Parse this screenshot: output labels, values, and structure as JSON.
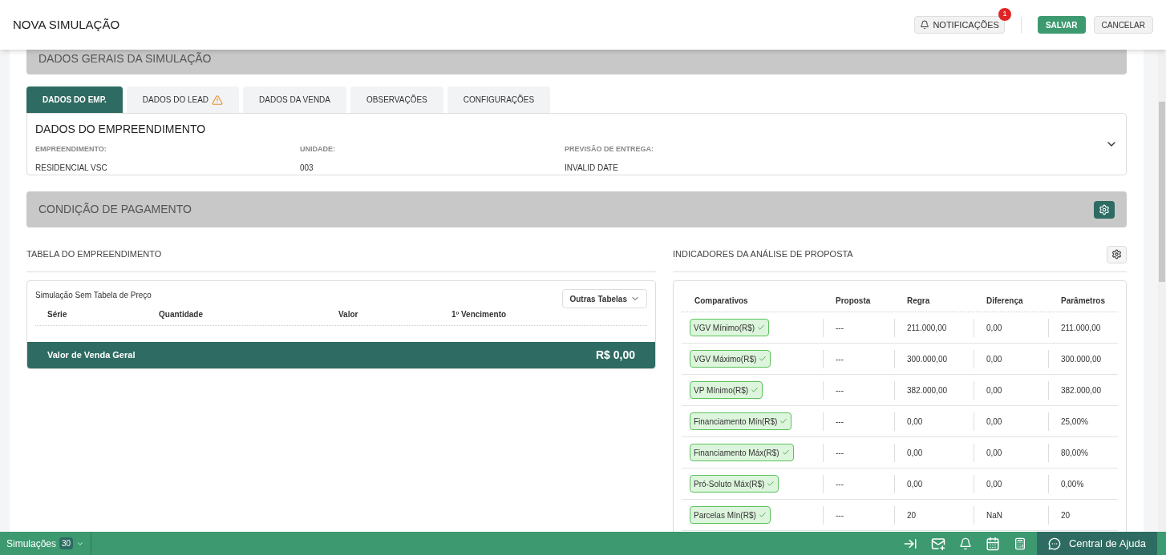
{
  "header": {
    "title": "NOVA SIMULAÇÃO",
    "notifications": {
      "label": "NOTIFICAÇÕES",
      "count": "1"
    },
    "buttons": [
      "SALVAR",
      "CANCELAR"
    ]
  },
  "general_section": {
    "title": "DADOS GERAIS DA SIMULAÇÃO"
  },
  "tabs": [
    {
      "label": "DADOS DO EMP.",
      "selected": true,
      "warning": false
    },
    {
      "label": "DADOS DO LEAD",
      "selected": false,
      "warning": true
    },
    {
      "label": "DADOS DA VENDA",
      "selected": false,
      "warning": false
    },
    {
      "label": "OBSERVAÇÕES",
      "selected": false,
      "warning": false
    },
    {
      "label": "CONFIGURAÇÕES",
      "selected": false,
      "warning": false
    }
  ],
  "empreendimento": {
    "title": "DADOS DO EMPREENDIMENTO",
    "expanded": false,
    "fields": [
      {
        "label": "EMPREENDIMENTO:",
        "value": "RESIDENCIAL VSC"
      },
      {
        "label": "UNIDADE:",
        "value": "003"
      },
      {
        "label": "PREVISÃO DE ENTREGA:",
        "value": "INVALID DATE"
      }
    ]
  },
  "payment_section": {
    "title": "CONDIÇÃO DE PAGAMENTO"
  },
  "price_table": {
    "title": "TABELA DO EMPREENDIMENTO",
    "subtitle": "Simulação Sem Tabela de Preço",
    "dropdown": "Outras Tabelas",
    "columns": [
      "Série",
      "Quantidade",
      "Valor",
      "1º Vencimento"
    ],
    "total_label": "Valor de Venda Geral",
    "total_value": "R$ 0,00"
  },
  "indicators": {
    "title": "INDICADORES DA ANÁLISE DE PROPOSTA",
    "columns": [
      "Comparativos",
      "Proposta",
      "Regra",
      "Diferença",
      "Parâmetros"
    ],
    "rows": [
      {
        "name": "VGV Mínimo(R$)",
        "passed": true,
        "proposta": "---",
        "regra": "211.000,00",
        "diferenca": "0,00",
        "parametros": "211.000,00"
      },
      {
        "name": "VGV Máximo(R$)",
        "passed": true,
        "proposta": "---",
        "regra": "300.000,00",
        "diferenca": "0,00",
        "parametros": "300.000,00"
      },
      {
        "name": "VP Mínimo(R$)",
        "passed": true,
        "proposta": "---",
        "regra": "382.000,00",
        "diferenca": "0,00",
        "parametros": "382.000,00"
      },
      {
        "name": "Financiamento Mín(R$)",
        "passed": true,
        "proposta": "---",
        "regra": "0,00",
        "diferenca": "0,00",
        "parametros": "25,00%"
      },
      {
        "name": "Financiamento Máx(R$)",
        "passed": true,
        "proposta": "---",
        "regra": "0,00",
        "diferenca": "0,00",
        "parametros": "80,00%"
      },
      {
        "name": "Pró-Soluto Máx(R$)",
        "passed": true,
        "proposta": "---",
        "regra": "0,00",
        "diferenca": "0,00",
        "parametros": "0,00%"
      },
      {
        "name": "Parcelas Mín(R$)",
        "passed": true,
        "proposta": "---",
        "regra": "20",
        "diferenca": "NaN",
        "parametros": "20"
      }
    ]
  },
  "bottom_bar": {
    "simulations_label": "Simulações",
    "simulations_count": "30",
    "help_label": "Central de Ajuda"
  }
}
